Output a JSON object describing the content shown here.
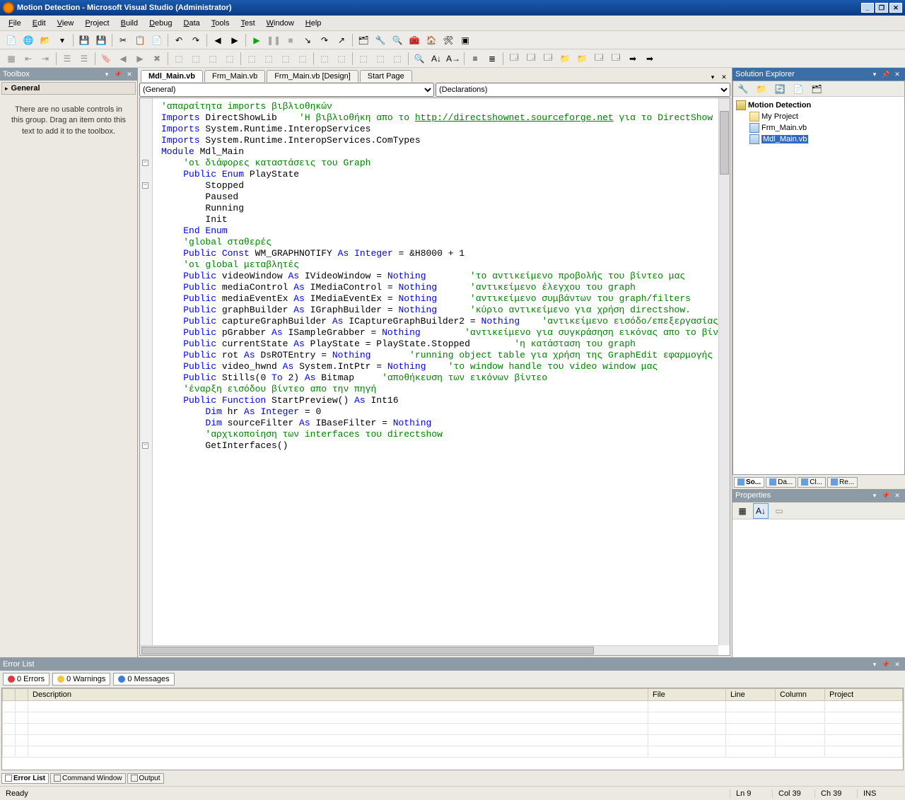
{
  "title": "Motion Detection - Microsoft Visual Studio (Administrator)",
  "menu": [
    "File",
    "Edit",
    "View",
    "Project",
    "Build",
    "Debug",
    "Data",
    "Tools",
    "Test",
    "Window",
    "Help"
  ],
  "toolbox": {
    "title": "Toolbox",
    "category": "General",
    "empty": "There are no usable controls in this group. Drag an item onto this text to add it to the toolbox."
  },
  "tabs": [
    {
      "label": "Mdl_Main.vb",
      "active": true
    },
    {
      "label": "Frm_Main.vb",
      "active": false
    },
    {
      "label": "Frm_Main.vb [Design]",
      "active": false
    },
    {
      "label": "Start Page",
      "active": false
    }
  ],
  "dropdown_left": "(General)",
  "dropdown_right": "(Declarations)",
  "code_lines": [
    {
      "t": "cm",
      "s": "'απαραίτητα imports βιβλιοθηκών"
    },
    {
      "t": "mix",
      "parts": [
        [
          "kw",
          "Imports"
        ],
        [
          "",
          " DirectShowLib    "
        ],
        [
          "cm",
          "'Η βιβλιοθήκη απο το "
        ],
        [
          "lnk",
          "http://directshownet.sourceforge.net"
        ],
        [
          "cm",
          " για το DirectShow"
        ]
      ]
    },
    {
      "t": "mix",
      "parts": [
        [
          "kw",
          "Imports"
        ],
        [
          "",
          " System.Runtime.InteropServices"
        ]
      ]
    },
    {
      "t": "mix",
      "parts": [
        [
          "kw",
          "Imports"
        ],
        [
          "",
          " System.Runtime.InteropServices.ComTypes"
        ]
      ]
    },
    {
      "t": "",
      "s": ""
    },
    {
      "t": "mix",
      "toggle": "-",
      "parts": [
        [
          "kw",
          "Module"
        ],
        [
          "",
          " Mdl_Main"
        ]
      ]
    },
    {
      "t": "cm",
      "s": "    'οι διάφορες καταστάσεις του Graph"
    },
    {
      "t": "mix",
      "toggle": "-",
      "parts": [
        [
          "",
          "    "
        ],
        [
          "kw",
          "Public Enum"
        ],
        [
          "",
          " PlayState"
        ]
      ]
    },
    {
      "t": "",
      "s": "        Stopped"
    },
    {
      "t": "",
      "s": "        Paused"
    },
    {
      "t": "",
      "s": "        Running"
    },
    {
      "t": "",
      "s": "        Init"
    },
    {
      "t": "mix",
      "parts": [
        [
          "",
          "    "
        ],
        [
          "kw",
          "End Enum"
        ]
      ]
    },
    {
      "t": "",
      "s": ""
    },
    {
      "t": "cm",
      "s": "    'global σταθερές"
    },
    {
      "t": "mix",
      "parts": [
        [
          "",
          "    "
        ],
        [
          "kw",
          "Public Const"
        ],
        [
          "",
          " WM_GRAPHNOTIFY "
        ],
        [
          "kw",
          "As Integer"
        ],
        [
          "",
          " = &H8000 + 1"
        ]
      ]
    },
    {
      "t": "",
      "s": ""
    },
    {
      "t": "cm",
      "s": "    'οι global μεταβλητές"
    },
    {
      "t": "mix",
      "parts": [
        [
          "",
          "    "
        ],
        [
          "kw",
          "Public"
        ],
        [
          "",
          " videoWindow "
        ],
        [
          "kw",
          "As"
        ],
        [
          "",
          " IVideoWindow = "
        ],
        [
          "kw",
          "Nothing"
        ],
        [
          "",
          "        "
        ],
        [
          "cm",
          "'το αντικείμενο προβολής του βίντεο μας"
        ]
      ]
    },
    {
      "t": "mix",
      "parts": [
        [
          "",
          "    "
        ],
        [
          "kw",
          "Public"
        ],
        [
          "",
          " mediaControl "
        ],
        [
          "kw",
          "As"
        ],
        [
          "",
          " IMediaControl = "
        ],
        [
          "kw",
          "Nothing"
        ],
        [
          "",
          "      "
        ],
        [
          "cm",
          "'αντικείμενο έλεγχου του graph"
        ]
      ]
    },
    {
      "t": "mix",
      "parts": [
        [
          "",
          "    "
        ],
        [
          "kw",
          "Public"
        ],
        [
          "",
          " mediaEventEx "
        ],
        [
          "kw",
          "As"
        ],
        [
          "",
          " IMediaEventEx = "
        ],
        [
          "kw",
          "Nothing"
        ],
        [
          "",
          "      "
        ],
        [
          "cm",
          "'αντικείμενο συμβάντων του graph/filters"
        ]
      ]
    },
    {
      "t": "mix",
      "parts": [
        [
          "",
          "    "
        ],
        [
          "kw",
          "Public"
        ],
        [
          "",
          " graphBuilder "
        ],
        [
          "kw",
          "As"
        ],
        [
          "",
          " IGraphBuilder = "
        ],
        [
          "kw",
          "Nothing"
        ],
        [
          "",
          "      "
        ],
        [
          "cm",
          "'κύριο αντικείμενο για χρήση directshow."
        ]
      ]
    },
    {
      "t": "mix",
      "parts": [
        [
          "",
          "    "
        ],
        [
          "kw",
          "Public"
        ],
        [
          "",
          " captureGraphBuilder "
        ],
        [
          "kw",
          "As"
        ],
        [
          "",
          " ICaptureGraphBuilder2 = "
        ],
        [
          "kw",
          "Nothing"
        ],
        [
          "",
          "    "
        ],
        [
          "cm",
          "'αντικείμενο εισόδο/επεξεργασίας τ"
        ]
      ]
    },
    {
      "t": "mix",
      "parts": [
        [
          "",
          "    "
        ],
        [
          "kw",
          "Public"
        ],
        [
          "",
          " pGrabber "
        ],
        [
          "kw",
          "As"
        ],
        [
          "",
          " ISampleGrabber = "
        ],
        [
          "kw",
          "Nothing"
        ],
        [
          "",
          "        "
        ],
        [
          "cm",
          "'αντικείμενο για συγκράσηση εικόνας απο το βίν"
        ]
      ]
    },
    {
      "t": "mix",
      "parts": [
        [
          "",
          "    "
        ],
        [
          "kw",
          "Public"
        ],
        [
          "",
          " currentState "
        ],
        [
          "kw",
          "As"
        ],
        [
          "",
          " PlayState = PlayState.Stopped        "
        ],
        [
          "cm",
          "'η κατάσταση του graph"
        ]
      ]
    },
    {
      "t": "mix",
      "parts": [
        [
          "",
          "    "
        ],
        [
          "kw",
          "Public"
        ],
        [
          "",
          " rot "
        ],
        [
          "kw",
          "As"
        ],
        [
          "",
          " DsROTEntry = "
        ],
        [
          "kw",
          "Nothing"
        ],
        [
          "",
          "       "
        ],
        [
          "cm",
          "'running object table για χρήση της GraphEdit εφαρμογής"
        ]
      ]
    },
    {
      "t": "mix",
      "parts": [
        [
          "",
          "    "
        ],
        [
          "kw",
          "Public"
        ],
        [
          "",
          " video_hwnd "
        ],
        [
          "kw",
          "As"
        ],
        [
          "",
          " System.IntPtr = "
        ],
        [
          "kw",
          "Nothing"
        ],
        [
          "",
          "    "
        ],
        [
          "cm",
          "'το window handle του video window μας"
        ]
      ]
    },
    {
      "t": "mix",
      "parts": [
        [
          "",
          "    "
        ],
        [
          "kw",
          "Public"
        ],
        [
          "",
          " Stills(0 "
        ],
        [
          "kw",
          "To"
        ],
        [
          "",
          " 2) "
        ],
        [
          "kw",
          "As"
        ],
        [
          "",
          " Bitmap     "
        ],
        [
          "cm",
          "'αποθήκευση των εικόνων βίντεο"
        ]
      ]
    },
    {
      "t": "",
      "s": ""
    },
    {
      "t": "cm",
      "s": "    'έναρξη εισόδου βίντεο απο την πηγή"
    },
    {
      "t": "mix",
      "toggle": "-",
      "parts": [
        [
          "",
          "    "
        ],
        [
          "kw",
          "Public Function"
        ],
        [
          "",
          " StartPreview() "
        ],
        [
          "kw",
          "As"
        ],
        [
          "",
          " Int16"
        ]
      ]
    },
    {
      "t": "mix",
      "parts": [
        [
          "",
          "        "
        ],
        [
          "kw",
          "Dim"
        ],
        [
          "",
          " hr "
        ],
        [
          "kw",
          "As Integer"
        ],
        [
          "",
          " = 0"
        ]
      ]
    },
    {
      "t": "mix",
      "parts": [
        [
          "",
          "        "
        ],
        [
          "kw",
          "Dim"
        ],
        [
          "",
          " sourceFilter "
        ],
        [
          "kw",
          "As"
        ],
        [
          "",
          " IBaseFilter = "
        ],
        [
          "kw",
          "Nothing"
        ]
      ]
    },
    {
      "t": "",
      "s": ""
    },
    {
      "t": "cm",
      "s": "        'αρχικοποίηση των interfaces του directshow"
    },
    {
      "t": "",
      "s": "        GetInterfaces()"
    }
  ],
  "solution_explorer": {
    "title": "Solution Explorer",
    "project": "Motion Detection",
    "items": [
      "My Project",
      "Frm_Main.vb",
      "Mdl_Main.vb"
    ],
    "selected": "Mdl_Main.vb",
    "bottom_tabs": [
      "So...",
      "Da...",
      "Cl...",
      "Re..."
    ]
  },
  "properties": {
    "title": "Properties"
  },
  "errlist": {
    "title": "Error List",
    "filters": {
      "errors": "0 Errors",
      "warnings": "0 Warnings",
      "messages": "0 Messages"
    },
    "cols": [
      "",
      "",
      "Description",
      "File",
      "Line",
      "Column",
      "Project"
    ],
    "bottom_tabs": [
      "Error List",
      "Command Window",
      "Output"
    ]
  },
  "status": {
    "ready": "Ready",
    "ln": "Ln 9",
    "col": "Col 39",
    "ch": "Ch 39",
    "ins": "INS"
  }
}
